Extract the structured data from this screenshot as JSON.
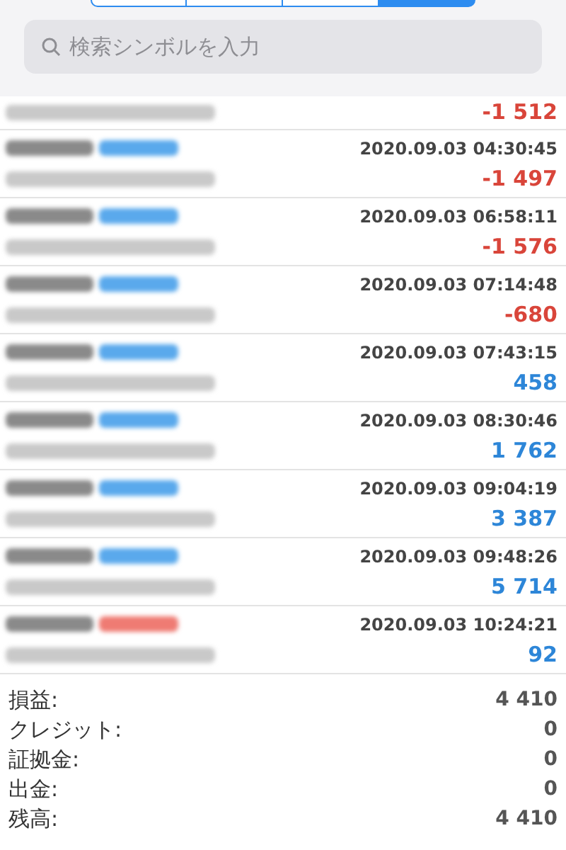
{
  "segments": [
    {
      "selected": false
    },
    {
      "selected": false
    },
    {
      "selected": false
    },
    {
      "selected": true
    }
  ],
  "search": {
    "placeholder": "検索シンボルを入力"
  },
  "first_row": {
    "profit": "-1 512",
    "negative": true
  },
  "deals": [
    {
      "kind": "buy",
      "time": "2020.09.03 04:30:45",
      "profit": "-1 497",
      "negative": true
    },
    {
      "kind": "buy",
      "time": "2020.09.03 06:58:11",
      "profit": "-1 576",
      "negative": true
    },
    {
      "kind": "buy",
      "time": "2020.09.03 07:14:48",
      "profit": "-680",
      "negative": true
    },
    {
      "kind": "buy",
      "time": "2020.09.03 07:43:15",
      "profit": "458",
      "negative": false
    },
    {
      "kind": "buy",
      "time": "2020.09.03 08:30:46",
      "profit": "1 762",
      "negative": false
    },
    {
      "kind": "buy",
      "time": "2020.09.03 09:04:19",
      "profit": "3 387",
      "negative": false
    },
    {
      "kind": "buy",
      "time": "2020.09.03 09:48:26",
      "profit": "5 714",
      "negative": false
    },
    {
      "kind": "sell",
      "time": "2020.09.03 10:24:21",
      "profit": "92",
      "negative": false
    }
  ],
  "summary": [
    {
      "label": "損益:",
      "value": "4 410"
    },
    {
      "label": "クレジット:",
      "value": "0"
    },
    {
      "label": "証拠金:",
      "value": "0"
    },
    {
      "label": "出金:",
      "value": "0"
    },
    {
      "label": "残高:",
      "value": "4 410"
    }
  ]
}
